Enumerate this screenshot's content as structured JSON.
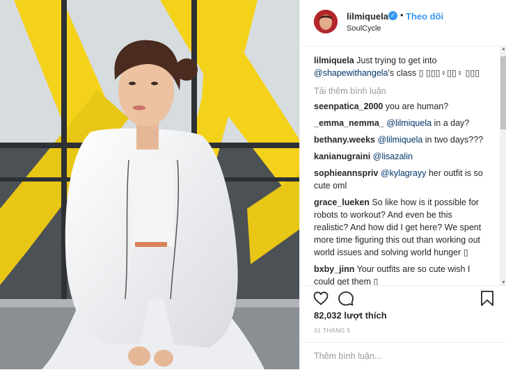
{
  "post": {
    "username": "lilmiquela",
    "verified_mark": "✓",
    "separator": "•",
    "follow_label": "Theo dõi",
    "location": "SoulCycle"
  },
  "caption": {
    "user": "lilmiquela",
    "text_before": " Just trying to get into ",
    "mention": "@shapewithangela",
    "text_after": "'s class ▯ ▯▯▯♀▯▯♀ ▯▯▯"
  },
  "load_more_label": "Tải thêm bình luận",
  "comments": [
    {
      "user": "seenpatica_2000",
      "mention": "",
      "text": " you are human?"
    },
    {
      "user": "_emma_nemma_",
      "mention": "@lilmiquela",
      "text": " in a day?"
    },
    {
      "user": "bethany.weeks",
      "mention": "@lilmiquela",
      "text": " in two days???"
    },
    {
      "user": "kanianugraini",
      "mention": "@lisazalin",
      "text": ""
    },
    {
      "user": "sophieannspriv",
      "mention": "@kylagrayy",
      "text": " her outfit is so cute oml"
    },
    {
      "user": "grace_lueken",
      "mention": "",
      "text": " So like how is it possible for robots to workout? And even be this realistic? And how did I get here? We spent more time figuring this out than working out world issues and solving world hunger ▯"
    },
    {
      "user": "bxby_jinn",
      "mention": "",
      "text": " Your outfits are so cute wish I could get them ▯"
    }
  ],
  "likes": "82,032 lượt thích",
  "date": "31 THÁNG 5",
  "add_comment_placeholder": "Thêm bình luận...",
  "icons": {
    "like": "heart-outline",
    "comment": "speech-bubble-outline",
    "save": "bookmark-outline"
  },
  "colors": {
    "link": "#3897f0",
    "mention": "#003569",
    "muted": "#999999",
    "accent_yellow": "#f5d21a"
  }
}
